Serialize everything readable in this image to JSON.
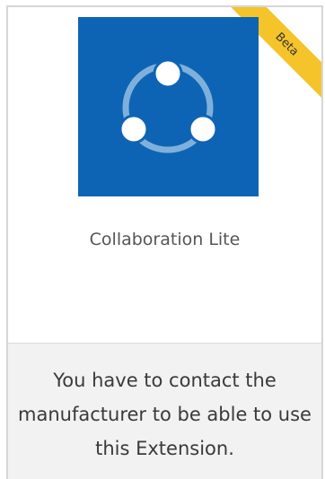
{
  "card": {
    "badge": "Beta",
    "title": "Collaboration Lite",
    "icon": "share-network-icon",
    "footer_message": "You have to contact the manufacturer to be able to use this Extension."
  },
  "colors": {
    "tile": "#0e64b4",
    "badge": "#f5c42b",
    "footer_bg": "#f2f2f2"
  }
}
